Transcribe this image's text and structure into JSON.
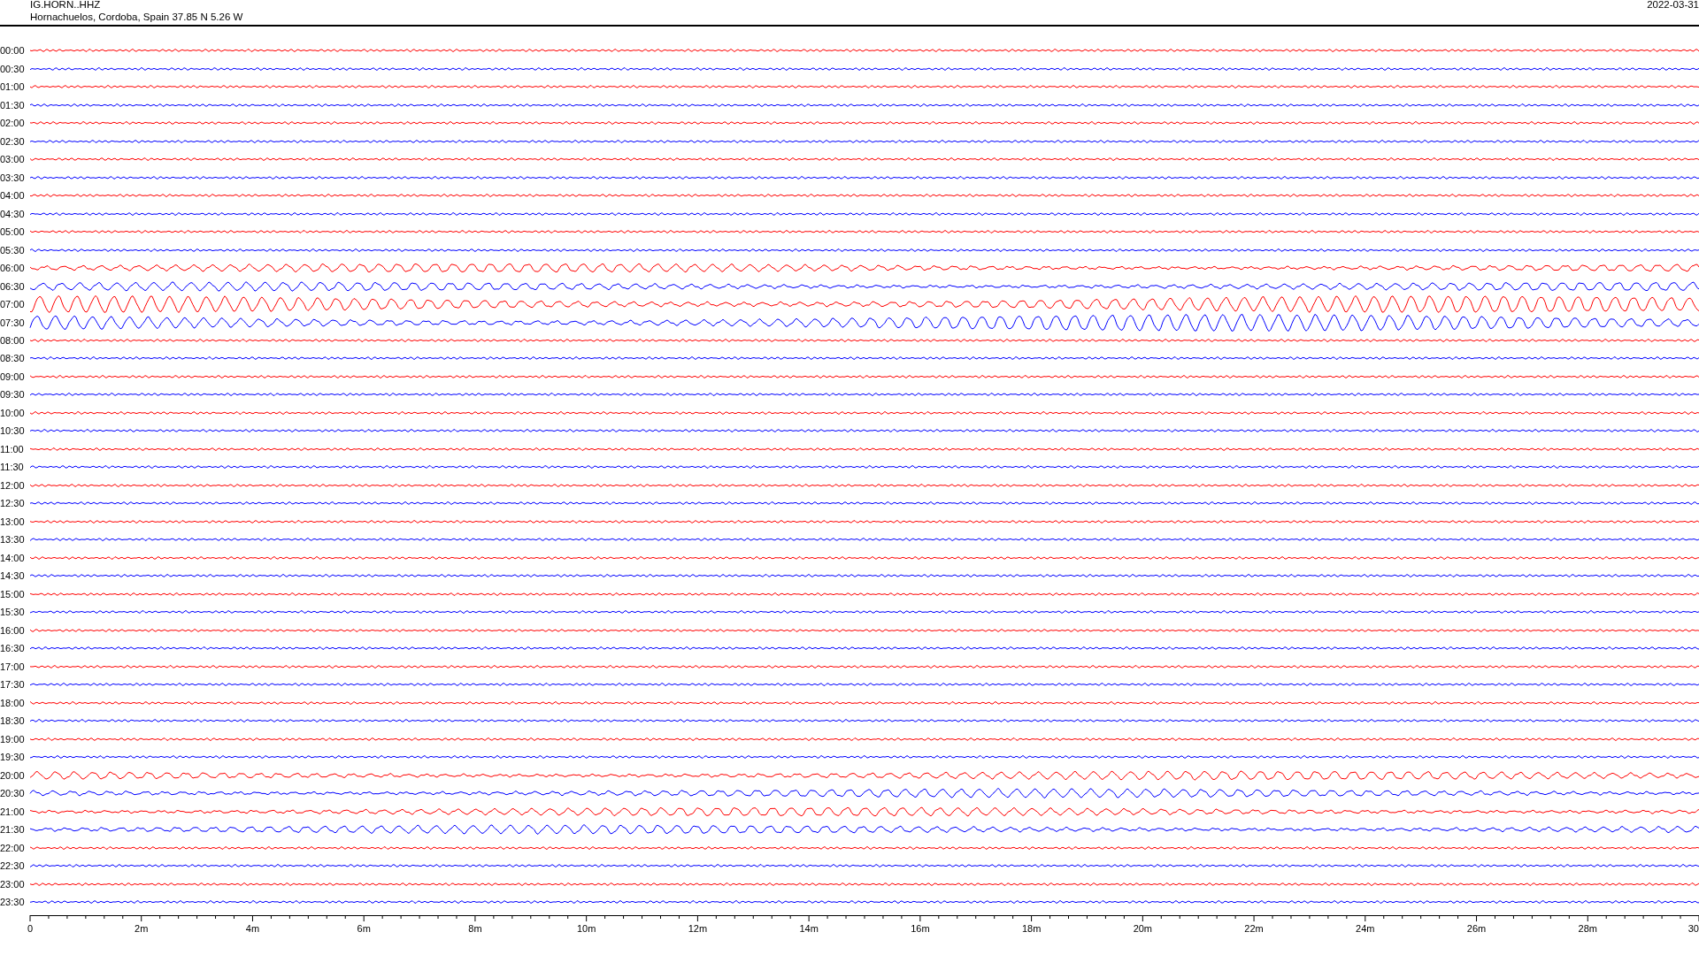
{
  "header": {
    "station": "IG.HORN..HHZ",
    "location": "Hornachuelos, Cordoba, Spain  37.85 N 5.26 W",
    "date": "2022-03-31"
  },
  "rows": [
    {
      "label": "00:00",
      "color": "#ff0000",
      "kind": "quiet"
    },
    {
      "label": "00:30",
      "color": "#0000ff",
      "kind": "quiet"
    },
    {
      "label": "01:00",
      "color": "#ff0000",
      "kind": "quiet"
    },
    {
      "label": "01:30",
      "color": "#0000ff",
      "kind": "quiet"
    },
    {
      "label": "02:00",
      "color": "#ff0000",
      "kind": "quiet"
    },
    {
      "label": "02:30",
      "color": "#0000ff",
      "kind": "quiet"
    },
    {
      "label": "03:00",
      "color": "#ff0000",
      "kind": "quiet"
    },
    {
      "label": "03:30",
      "color": "#0000ff",
      "kind": "quiet"
    },
    {
      "label": "04:00",
      "color": "#ff0000",
      "kind": "quiet"
    },
    {
      "label": "04:30",
      "color": "#0000ff",
      "kind": "quiet"
    },
    {
      "label": "05:00",
      "color": "#ff0000",
      "kind": "quiet"
    },
    {
      "label": "05:30",
      "color": "#0000ff",
      "kind": "quiet"
    },
    {
      "label": "06:00",
      "color": "#ff0000",
      "kind": "wave"
    },
    {
      "label": "06:30",
      "color": "#0000ff",
      "kind": "wave"
    },
    {
      "label": "07:00",
      "color": "#ff0000",
      "kind": "strong"
    },
    {
      "label": "07:30",
      "color": "#0000ff",
      "kind": "strong"
    },
    {
      "label": "08:00",
      "color": "#ff0000",
      "kind": "quiet"
    },
    {
      "label": "08:30",
      "color": "#0000ff",
      "kind": "quiet"
    },
    {
      "label": "09:00",
      "color": "#ff0000",
      "kind": "quiet"
    },
    {
      "label": "09:30",
      "color": "#0000ff",
      "kind": "quiet"
    },
    {
      "label": "10:00",
      "color": "#ff0000",
      "kind": "quiet"
    },
    {
      "label": "10:30",
      "color": "#0000ff",
      "kind": "quiet"
    },
    {
      "label": "11:00",
      "color": "#ff0000",
      "kind": "quiet"
    },
    {
      "label": "11:30",
      "color": "#0000ff",
      "kind": "quiet"
    },
    {
      "label": "12:00",
      "color": "#ff0000",
      "kind": "quiet"
    },
    {
      "label": "12:30",
      "color": "#0000ff",
      "kind": "quiet"
    },
    {
      "label": "13:00",
      "color": "#ff0000",
      "kind": "quiet"
    },
    {
      "label": "13:30",
      "color": "#0000ff",
      "kind": "quiet"
    },
    {
      "label": "14:00",
      "color": "#ff0000",
      "kind": "quiet"
    },
    {
      "label": "14:30",
      "color": "#0000ff",
      "kind": "quiet"
    },
    {
      "label": "15:00",
      "color": "#ff0000",
      "kind": "quiet"
    },
    {
      "label": "15:30",
      "color": "#0000ff",
      "kind": "quiet"
    },
    {
      "label": "16:00",
      "color": "#ff0000",
      "kind": "quiet"
    },
    {
      "label": "16:30",
      "color": "#0000ff",
      "kind": "quiet"
    },
    {
      "label": "17:00",
      "color": "#ff0000",
      "kind": "quiet"
    },
    {
      "label": "17:30",
      "color": "#0000ff",
      "kind": "quiet"
    },
    {
      "label": "18:00",
      "color": "#ff0000",
      "kind": "quiet"
    },
    {
      "label": "18:30",
      "color": "#0000ff",
      "kind": "quiet"
    },
    {
      "label": "19:00",
      "color": "#ff0000",
      "kind": "quiet"
    },
    {
      "label": "19:30",
      "color": "#0000ff",
      "kind": "quiet"
    },
    {
      "label": "20:00",
      "color": "#ff0000",
      "kind": "wave"
    },
    {
      "label": "20:30",
      "color": "#0000ff",
      "kind": "wave"
    },
    {
      "label": "21:00",
      "color": "#ff0000",
      "kind": "wave"
    },
    {
      "label": "21:30",
      "color": "#0000ff",
      "kind": "wave"
    },
    {
      "label": "22:00",
      "color": "#ff0000",
      "kind": "quiet"
    },
    {
      "label": "22:30",
      "color": "#0000ff",
      "kind": "quiet"
    },
    {
      "label": "23:00",
      "color": "#ff0000",
      "kind": "quiet"
    },
    {
      "label": "23:30",
      "color": "#0000ff",
      "kind": "quiet"
    }
  ],
  "axis": {
    "labels": [
      "0",
      "2m",
      "4m",
      "6m",
      "8m",
      "10m",
      "12m",
      "14m",
      "16m",
      "18m",
      "20m",
      "22m",
      "24m",
      "26m",
      "28m",
      "30"
    ]
  }
}
